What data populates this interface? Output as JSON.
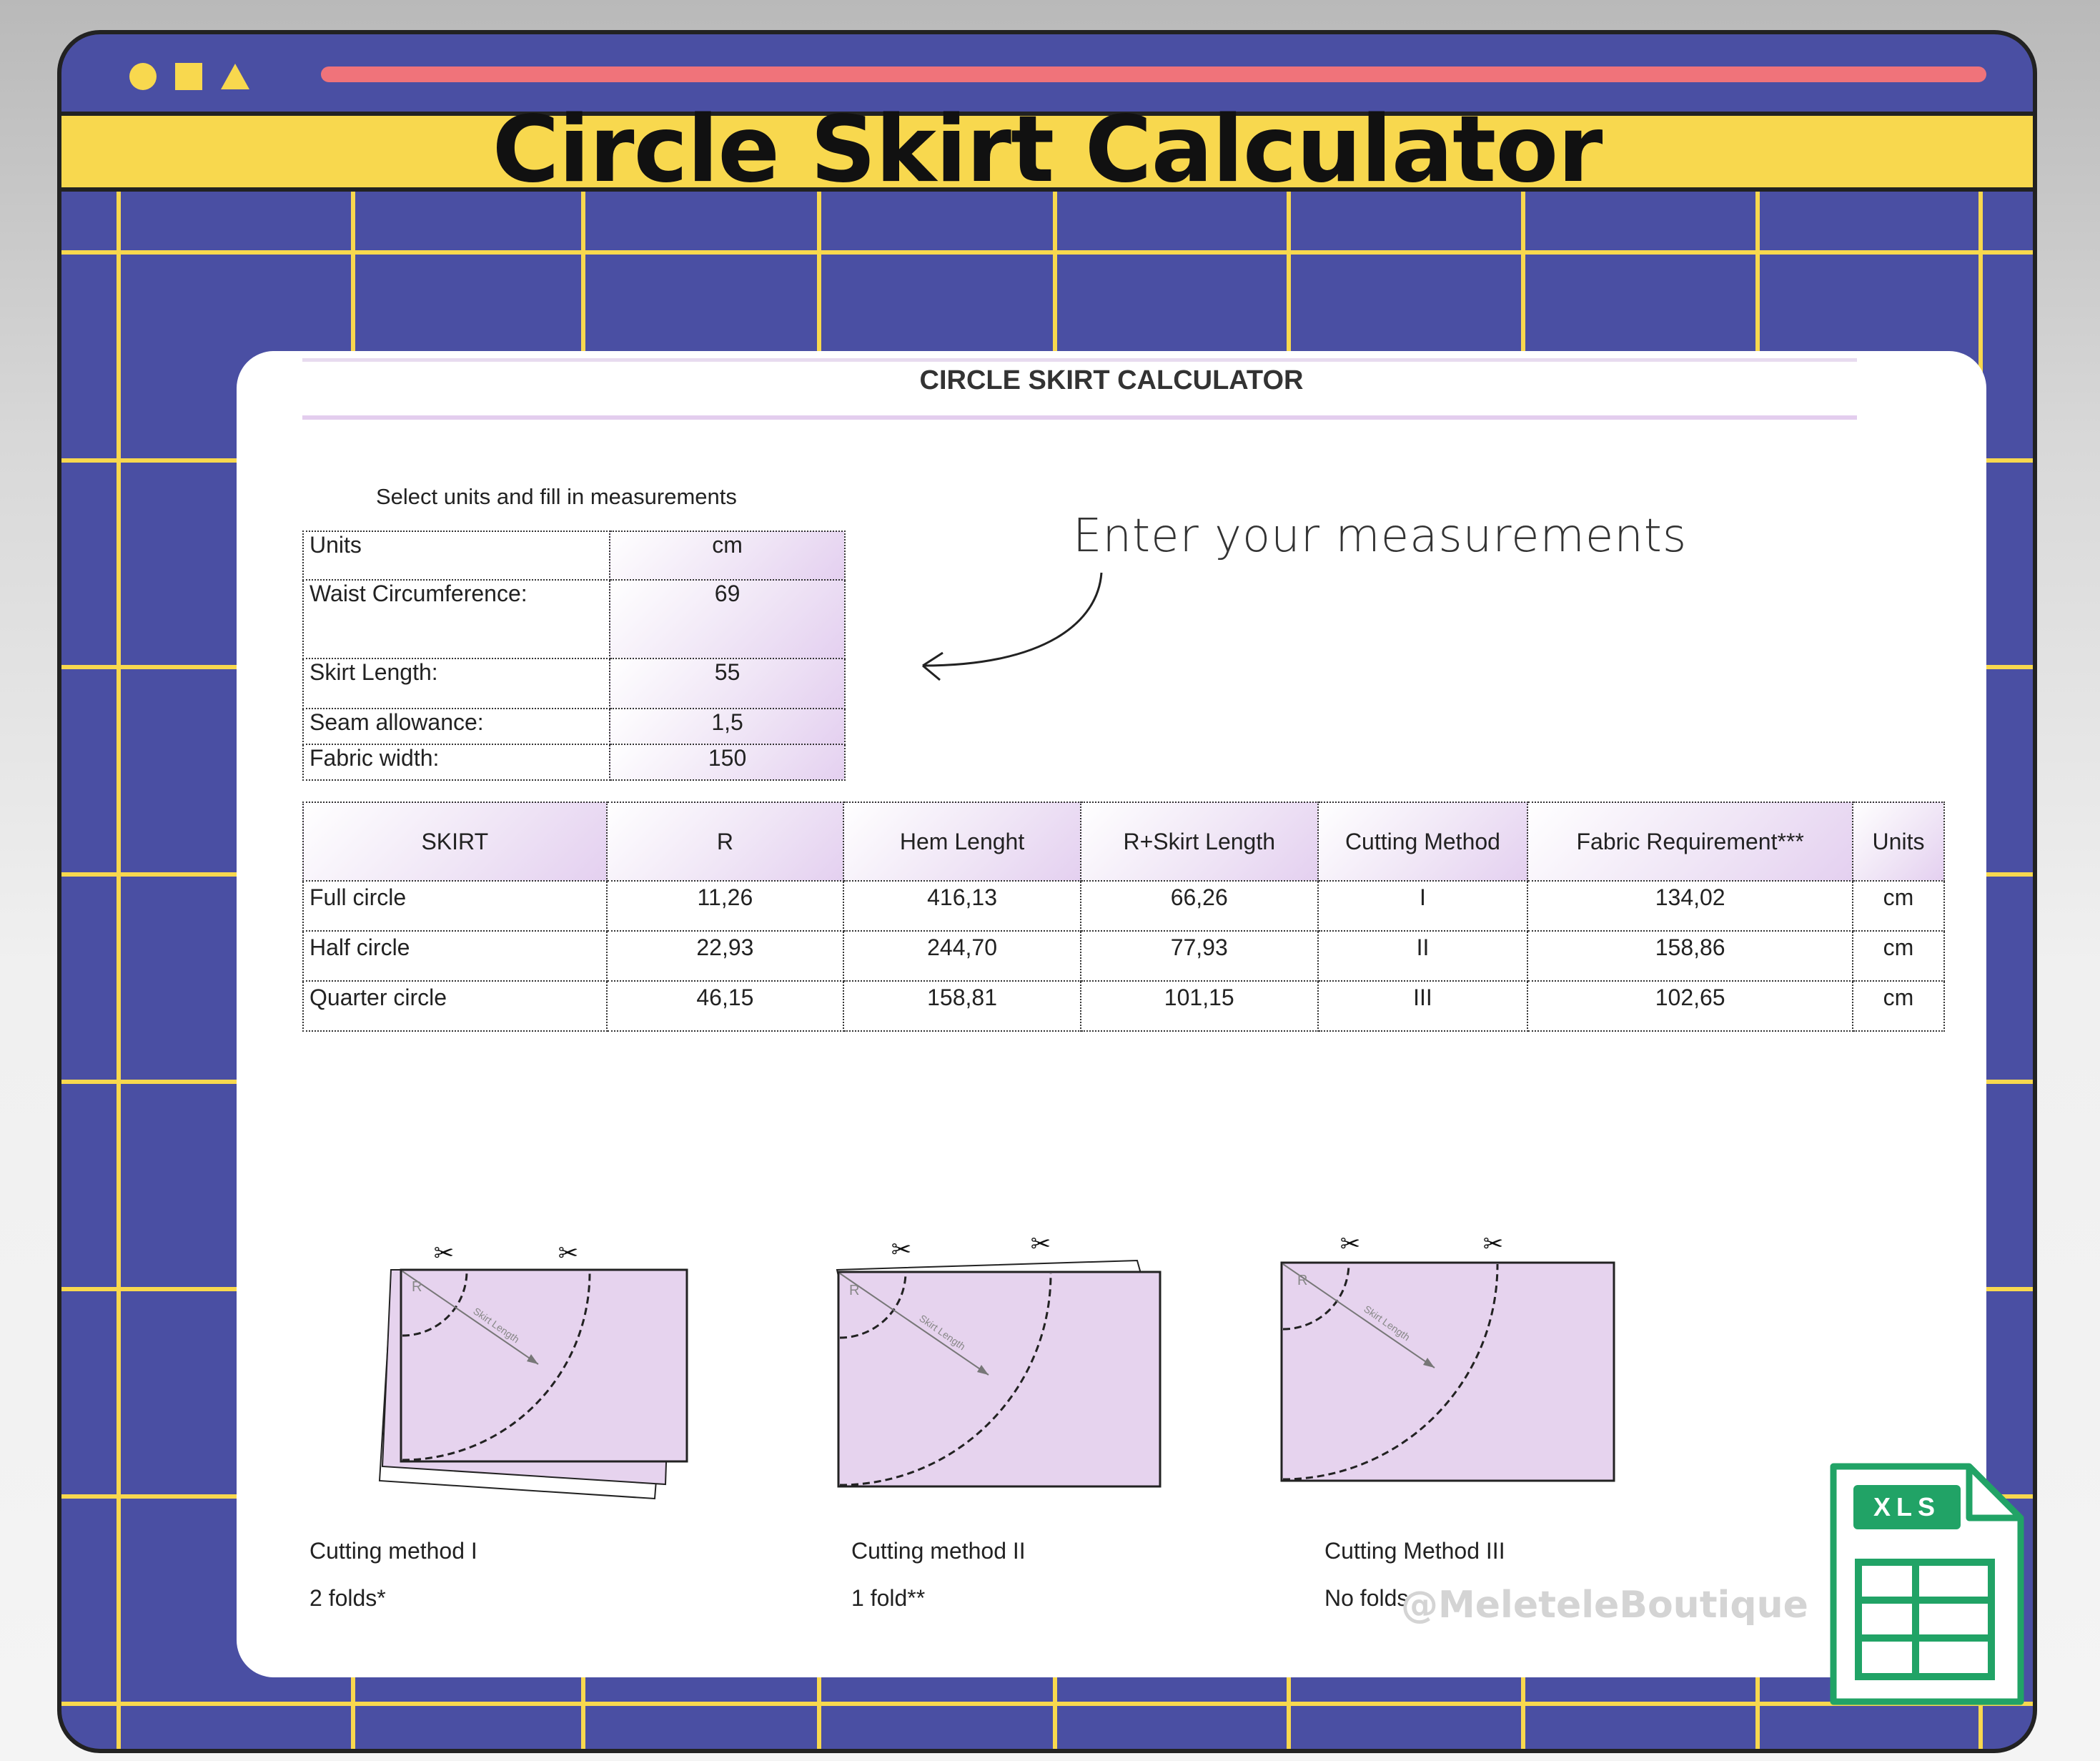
{
  "banner": {
    "title": "Circle Skirt Calculator"
  },
  "sheet": {
    "title": "CIRCLE SKIRT CALCULATOR",
    "instruction": "Select units and fill in measurements",
    "annotation": "Enter your measurements"
  },
  "inputs": [
    {
      "label": "Units",
      "value": "cm"
    },
    {
      "label": "Waist Circumference:",
      "value": "69"
    },
    {
      "label": "Skirt Length:",
      "value": "55"
    },
    {
      "label": "Seam allowance:",
      "value": "1,5"
    },
    {
      "label": "Fabric width:",
      "value": "150"
    }
  ],
  "results": {
    "headers": [
      "SKIRT",
      "R",
      "Hem Lenght",
      "R+Skirt Length",
      "Cutting Method",
      "Fabric Requirement***",
      "Units"
    ],
    "rows": [
      [
        "Full circle",
        "11,26",
        "416,13",
        "66,26",
        "I",
        "134,02",
        "cm"
      ],
      [
        "Half circle",
        "22,93",
        "244,70",
        "77,93",
        "II",
        "158,86",
        "cm"
      ],
      [
        "Quarter circle",
        "46,15",
        "158,81",
        "101,15",
        "III",
        "102,65",
        "cm"
      ]
    ]
  },
  "diagram_labels": {
    "radius": "R",
    "length": "Skirt Length"
  },
  "methods": [
    {
      "name": "Cutting method I",
      "folds": "2 folds*"
    },
    {
      "name": "Cutting method II",
      "folds": "1 fold**"
    },
    {
      "name": "Cutting Method III",
      "folds": "No folds"
    }
  ],
  "watermark": "@MeleteleBoutique",
  "file_badge": "XLS",
  "colors": {
    "frame_blue": "#4a4fa3",
    "grid_yellow": "#f8d84e",
    "address_red": "#f0737a",
    "fabric_lilac": "#e6d3ee",
    "excel_green": "#21a366"
  }
}
